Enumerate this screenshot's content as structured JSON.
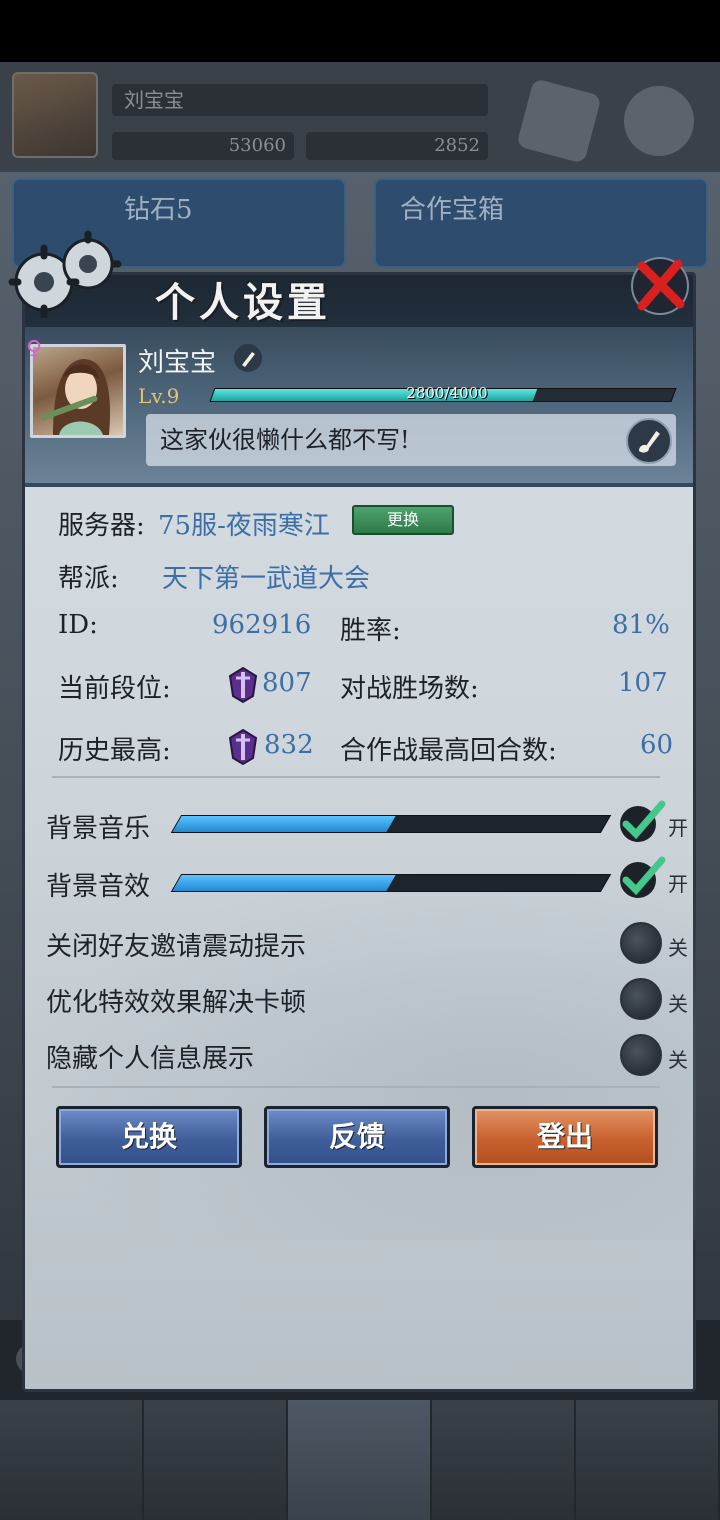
{
  "background": {
    "player_name": "刘宝宝",
    "coins": "53060",
    "gems": "2852",
    "card_left_label": "钻石5",
    "card_right_label": "合作宝箱"
  },
  "dialog": {
    "title": "个人设置",
    "close_icon": "close-x-icon"
  },
  "profile": {
    "gender_symbol": "♀",
    "name": "刘宝宝",
    "level": "Lv.9",
    "xp_text": "2800/4000",
    "xp_progress": 0.7,
    "signature": "这家伙很懒什么都不写!"
  },
  "info": {
    "server_label": "服务器:",
    "server_value": "75服-夜雨寒江",
    "change_button": "更换",
    "guild_label": "帮派:",
    "guild_value": "天下第一武道大会",
    "id_label": "ID:",
    "id_value": "962916",
    "winrate_label": "胜率:",
    "winrate_value": "81%",
    "rank_label": "当前段位:",
    "rank_value": "807",
    "wins_label": "对战胜场数:",
    "wins_value": "107",
    "best_label": "历史最高:",
    "best_value": "832",
    "coop_label": "合作战最高回合数:",
    "coop_value": "60"
  },
  "settings": {
    "music_label": "背景音乐",
    "music_level": 0.5,
    "music_state": "开",
    "sfx_label": "背景音效",
    "sfx_level": 0.5,
    "sfx_state": "开",
    "invite_label": "关闭好友邀请震动提示",
    "invite_state": "关",
    "effects_label": "优化特效效果解决卡顿",
    "effects_state": "关",
    "privacy_label": "隐藏个人信息展示",
    "privacy_state": "关"
  },
  "buttons": {
    "redeem": "兑换",
    "feedback": "反馈",
    "logout": "登出"
  },
  "colors": {
    "accent_blue": "#3d6fa6",
    "slider_blue": "#2189d0",
    "logout_orange": "#c8602f",
    "toggle_on_check": "#42c38a"
  }
}
